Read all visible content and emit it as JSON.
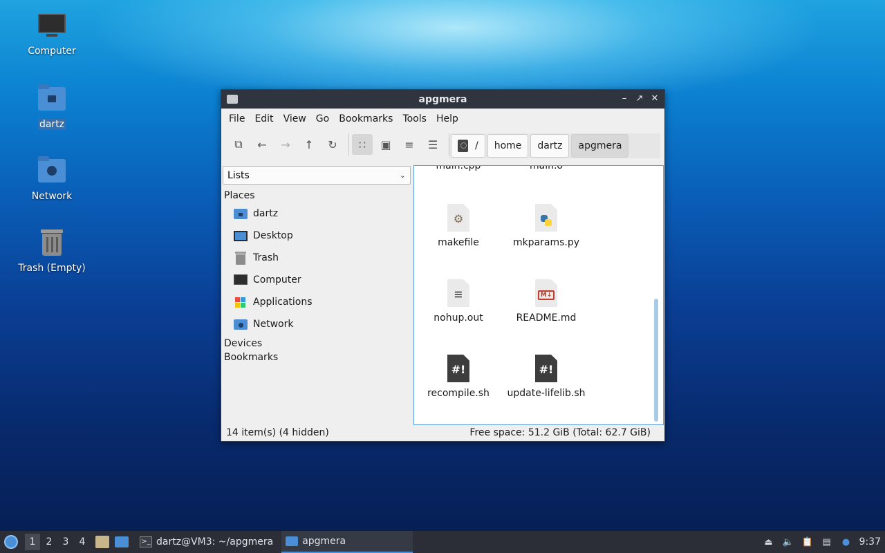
{
  "desktop": {
    "icons": [
      {
        "label": "Computer"
      },
      {
        "label": "dartz"
      },
      {
        "label": "Network"
      },
      {
        "label": "Trash (Empty)"
      }
    ]
  },
  "window": {
    "title": "apgmera",
    "menu": [
      "File",
      "Edit",
      "View",
      "Go",
      "Bookmarks",
      "Tools",
      "Help"
    ],
    "breadcrumb": [
      "/",
      "home",
      "dartz",
      "apgmera"
    ],
    "sidebar": {
      "combo": "Lists",
      "places_header": "Places",
      "places": [
        "dartz",
        "Desktop",
        "Trash",
        "Computer",
        "Applications",
        "Network"
      ],
      "devices_header": "Devices",
      "bookmarks_header": "Bookmarks"
    },
    "files": {
      "partial": [
        "main.cpp",
        "main.o"
      ],
      "items": [
        "makefile",
        "mkparams.py",
        "nohup.out",
        "README.md",
        "recompile.sh",
        "update-lifelib.sh"
      ]
    },
    "status": {
      "left": "14 item(s) (4 hidden)",
      "right": "Free space: 51.2 GiB (Total: 62.7 GiB)"
    }
  },
  "taskbar": {
    "workspaces": [
      "1",
      "2",
      "3",
      "4"
    ],
    "tasks": [
      "dartz@VM3: ~/apgmera",
      "apgmera"
    ],
    "clock": "9:37"
  },
  "colors": {
    "accent": "#4a90d9",
    "titlebar": "#2f343f",
    "taskbar": "#2b2e37"
  }
}
